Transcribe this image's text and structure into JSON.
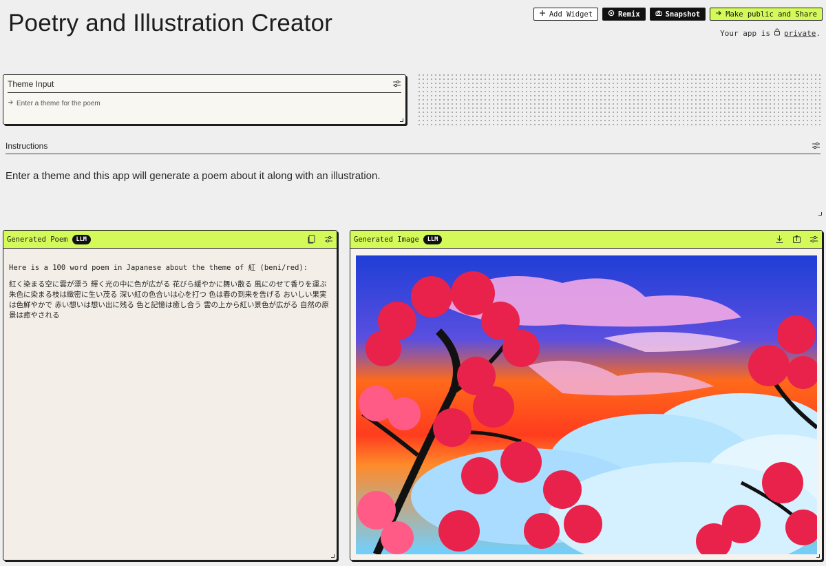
{
  "app": {
    "title": "Poetry and Illustration Creator"
  },
  "toolbar": {
    "add_widget": "Add Widget",
    "remix": "Remix",
    "snapshot": "Snapshot",
    "share": "Make public and Share"
  },
  "privacy": {
    "prefix": "Your app is",
    "status": "private",
    "suffix": "."
  },
  "theme_input": {
    "title": "Theme Input",
    "placeholder": "Enter a theme for the poem"
  },
  "instructions": {
    "title": "Instructions",
    "text": "Enter a theme and this app will generate a poem about it along with an illustration."
  },
  "poem_panel": {
    "title": "Generated Poem",
    "badge": "LLM",
    "intro": "Here is a 100 word poem in Japanese about the theme of 紅 (beni/red):",
    "body": "紅く染まる空に雲が漂う 輝く光の中に色が広がる 花びら緩やかに舞い散る 風にのせて香りを運ぶ 朱色に染まる枝は緻密に生い茂る 深い紅の色合いは心を打つ 色は春の到来を告げる おいしい果実は色鮮やかで 赤い想いは想い出に残る 色と記憶は癒し合う 雲の上から紅い景色が広がる 自然の原景は癒やされる"
  },
  "image_panel": {
    "title": "Generated Image",
    "badge": "LLM"
  },
  "icons": {
    "add": "plus-icon",
    "remix": "remix-icon",
    "snapshot": "camera-icon",
    "share": "arrow-right-icon",
    "lock": "lock-icon",
    "settings": "sliders-icon",
    "copy": "copy-icon",
    "download": "download-icon",
    "export": "export-icon"
  },
  "colors": {
    "accent": "#d4fa5a",
    "dark": "#111111",
    "background": "#efefef"
  }
}
